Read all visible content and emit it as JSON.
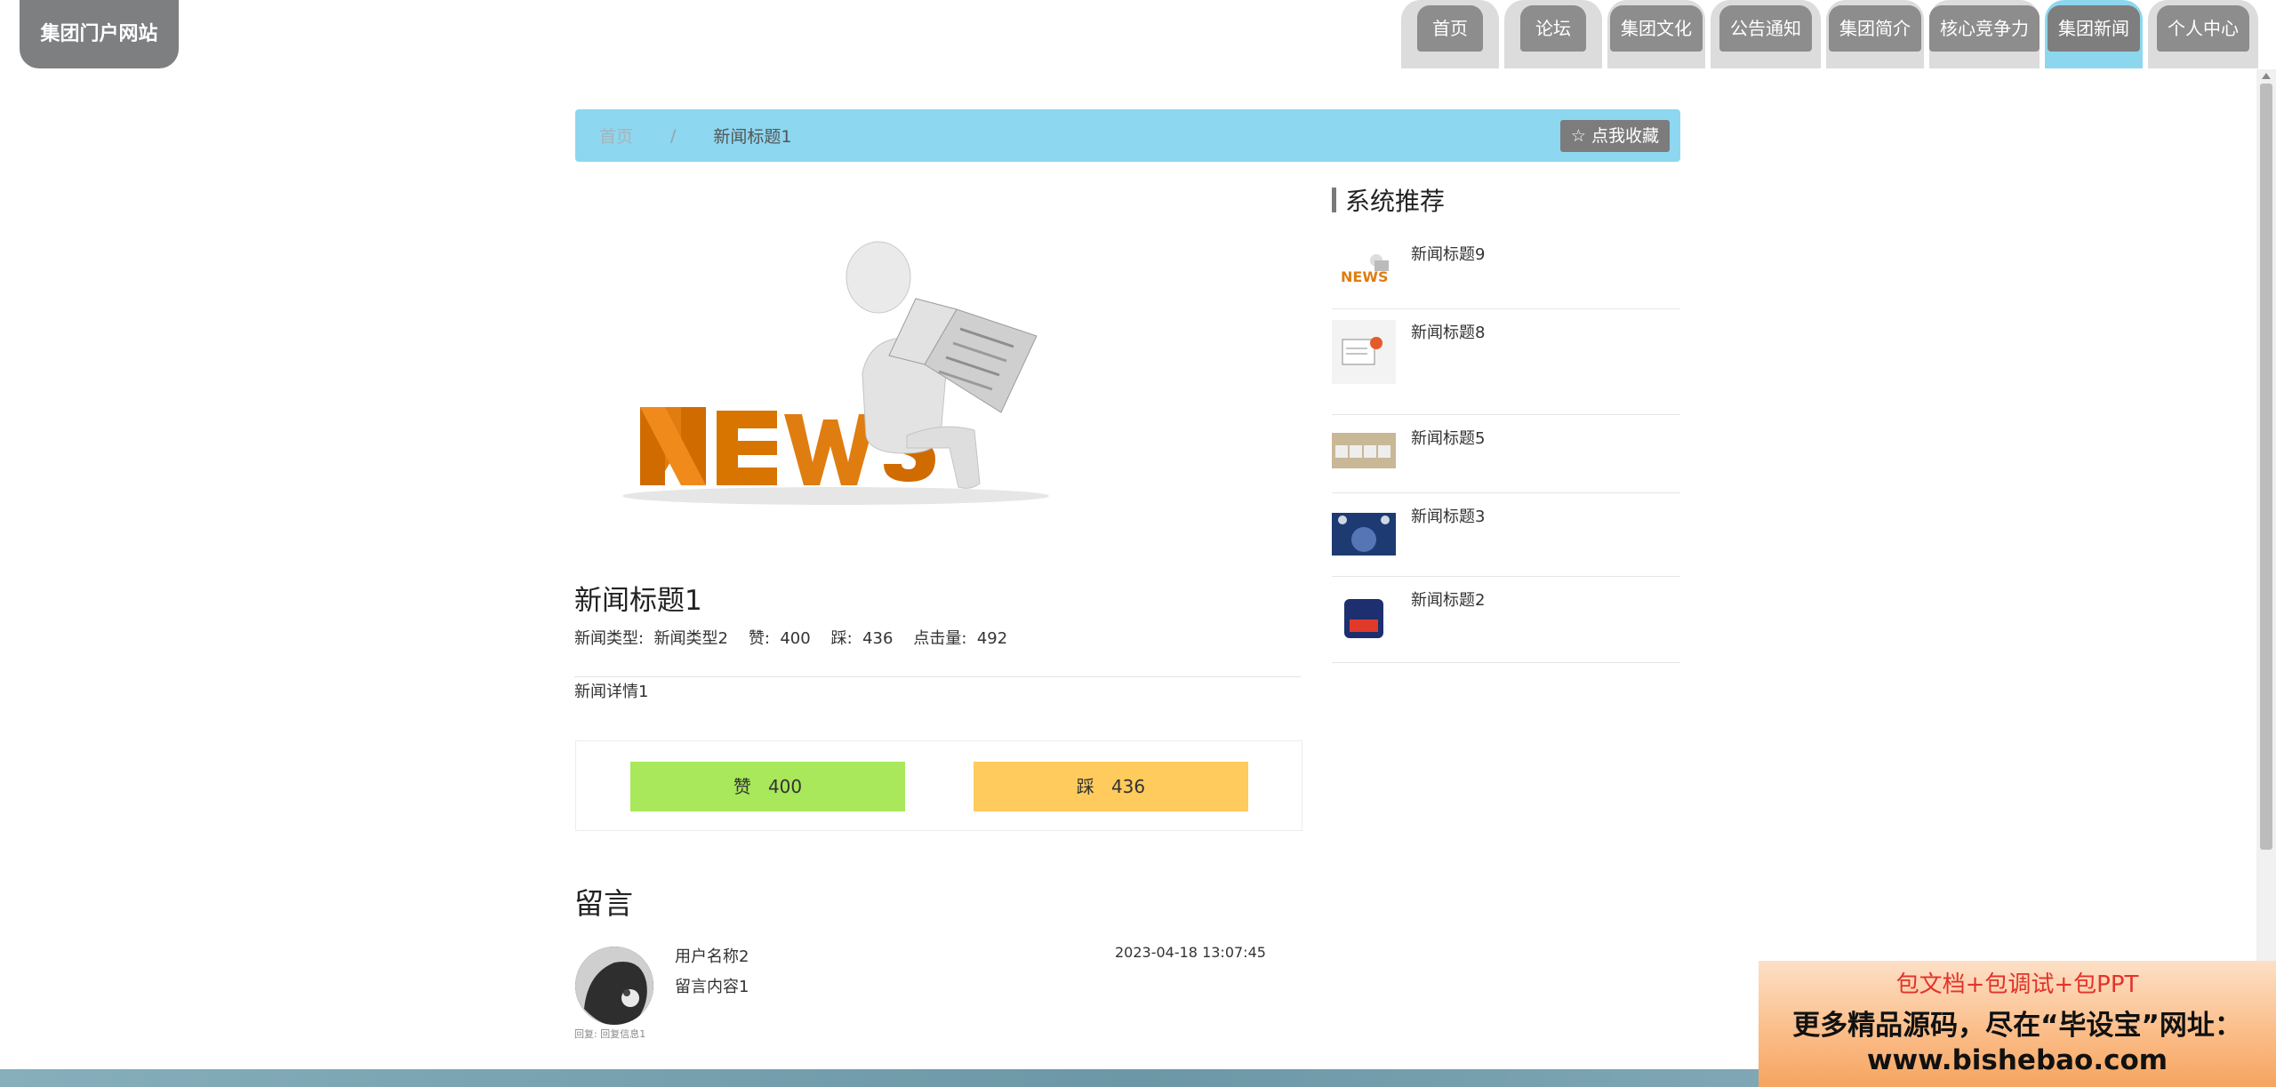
{
  "site": {
    "title": "集团门户网站"
  },
  "nav": {
    "items": [
      {
        "label": "首页"
      },
      {
        "label": "论坛"
      },
      {
        "label": "集团文化"
      },
      {
        "label": "公告通知"
      },
      {
        "label": "集团简介"
      },
      {
        "label": "核心竞争力"
      },
      {
        "label": "集团新闻",
        "active": true
      },
      {
        "label": "个人中心"
      }
    ]
  },
  "breadcrumb": {
    "home": "首页",
    "separator": "/",
    "current": "新闻标题1"
  },
  "favorite": {
    "icon": "star-outline-icon",
    "label": "☆ 点我收藏"
  },
  "article": {
    "image_icon": "news-reader-illustration",
    "title": "新闻标题1",
    "meta": "新闻类型:  新闻类型2    赞:  400    踩:  436    点击量:  492",
    "detail": "新闻详情1"
  },
  "votes": {
    "like_label": "赞   400",
    "dislike_label": "踩   436",
    "like_color": "#a8e85a",
    "dislike_color": "#ffcb5c"
  },
  "comments": {
    "heading": "留言",
    "items": [
      {
        "user": "用户名称2",
        "content": "留言内容1",
        "time": "2023-04-18 13:07:45",
        "reply_caption": "回复: 回复信息1"
      }
    ]
  },
  "recommend": {
    "heading": "系统推荐",
    "items": [
      {
        "label": "新闻标题9"
      },
      {
        "label": "新闻标题8"
      },
      {
        "label": "新闻标题5"
      },
      {
        "label": "新闻标题3"
      },
      {
        "label": "新闻标题2"
      }
    ]
  },
  "watermark": {
    "line1": "包文档+包调试+包PPT",
    "line2": "更多精品源码，尽在“毕设宝”网址：",
    "line3": "www.bishebao.com"
  },
  "colors": {
    "accent": "#8dd7f0",
    "nav_bg": "#8d8d8d",
    "logo_bg": "#7d7f80"
  }
}
